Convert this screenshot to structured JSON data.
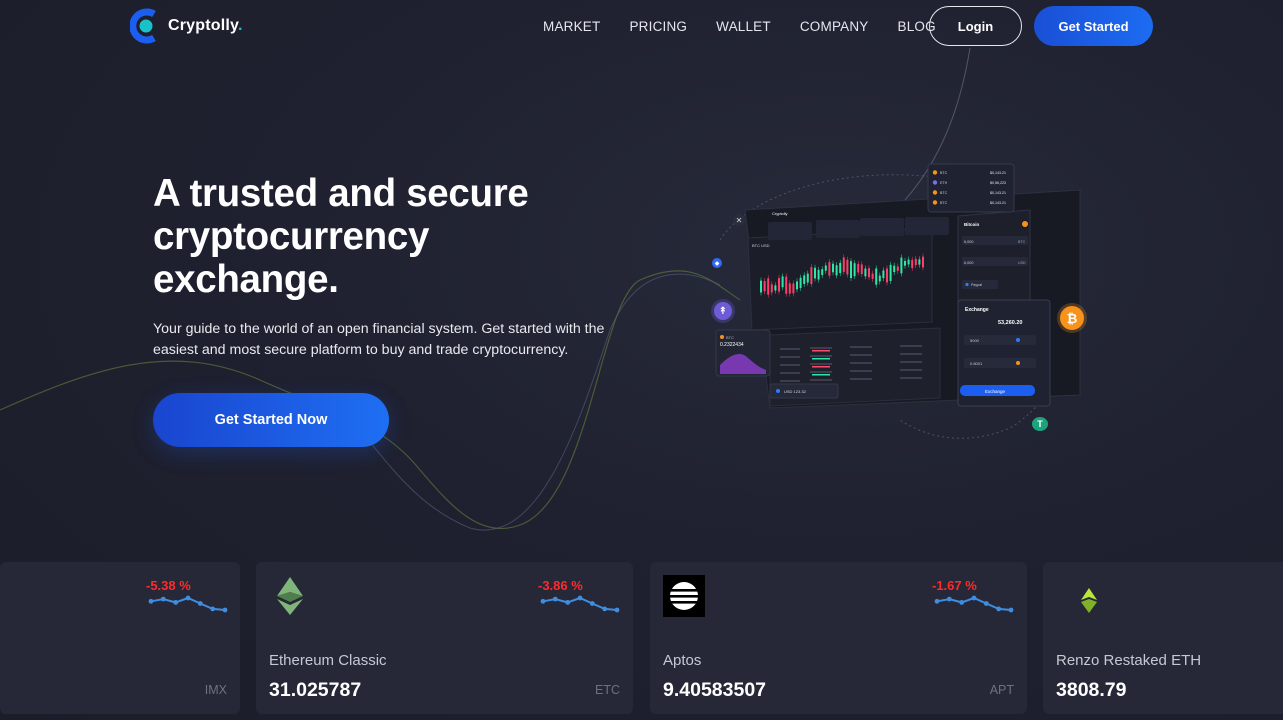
{
  "brand": {
    "name": "Cryptolly",
    "dot": ".",
    "accent": "#19c2c9",
    "primary": "#1c5ff0"
  },
  "nav": {
    "items": [
      "MARKET",
      "PRICING",
      "WALLET",
      "COMPANY",
      "BLOG"
    ],
    "login_label": "Login",
    "get_started_label": "Get Started"
  },
  "hero": {
    "title_line1": "A trusted and secure",
    "title_line2": "cryptocurrency",
    "title_line3": "exchange.",
    "subtitle": "Your guide to the world of an open financial system. Get started with the easiest and most secure platform to buy and trade cryptocurrency.",
    "cta_label": "Get Started Now"
  },
  "mockup": {
    "brand": "Cryptolly",
    "pair": "BTC USD",
    "btc_label": "BTC",
    "btc_value": "0.2322434",
    "coin_panel_title": "Bitcoin",
    "amount_1": "6,000",
    "amount_2": "6,000",
    "unit_btc": "BTC",
    "unit_usd": "USD",
    "method": "Paypal",
    "exchange_title": "Exchange",
    "exchange_value": "53,260.20",
    "exchange_in": "5000",
    "exchange_out": "0.8001",
    "exchange_btn": "Exchange",
    "usd_value": "USD 123.32",
    "ticker_rows": [
      {
        "coin": "BTC",
        "price": "$0,143.21"
      },
      {
        "coin": "ETH",
        "price": "$0,56,223"
      },
      {
        "coin": "BTC",
        "price": "$0,143.21"
      },
      {
        "coin": "BTC",
        "price": "$0,143.21"
      }
    ]
  },
  "cards": [
    {
      "symbol": "IMX",
      "change": "-5.38 %",
      "name": "",
      "price": "",
      "icon": "none"
    },
    {
      "symbol": "ETC",
      "change": "-3.86 %",
      "name": "Ethereum Classic",
      "price": "31.025787",
      "icon": "ethereum-classic-icon"
    },
    {
      "symbol": "APT",
      "change": "-1.67 %",
      "name": "Aptos",
      "price": "9.40583507",
      "icon": "aptos-icon"
    },
    {
      "symbol": "",
      "change": "",
      "name": "Renzo Restaked ETH",
      "price": "3808.79",
      "icon": "renzo-eth-icon"
    }
  ],
  "sparkline_trend": [
    6,
    4,
    7,
    3,
    8,
    13,
    14
  ],
  "colors": {
    "negative": "#ff2a2a",
    "sparkline": "#3f8de0",
    "card_bg": "#262837"
  }
}
